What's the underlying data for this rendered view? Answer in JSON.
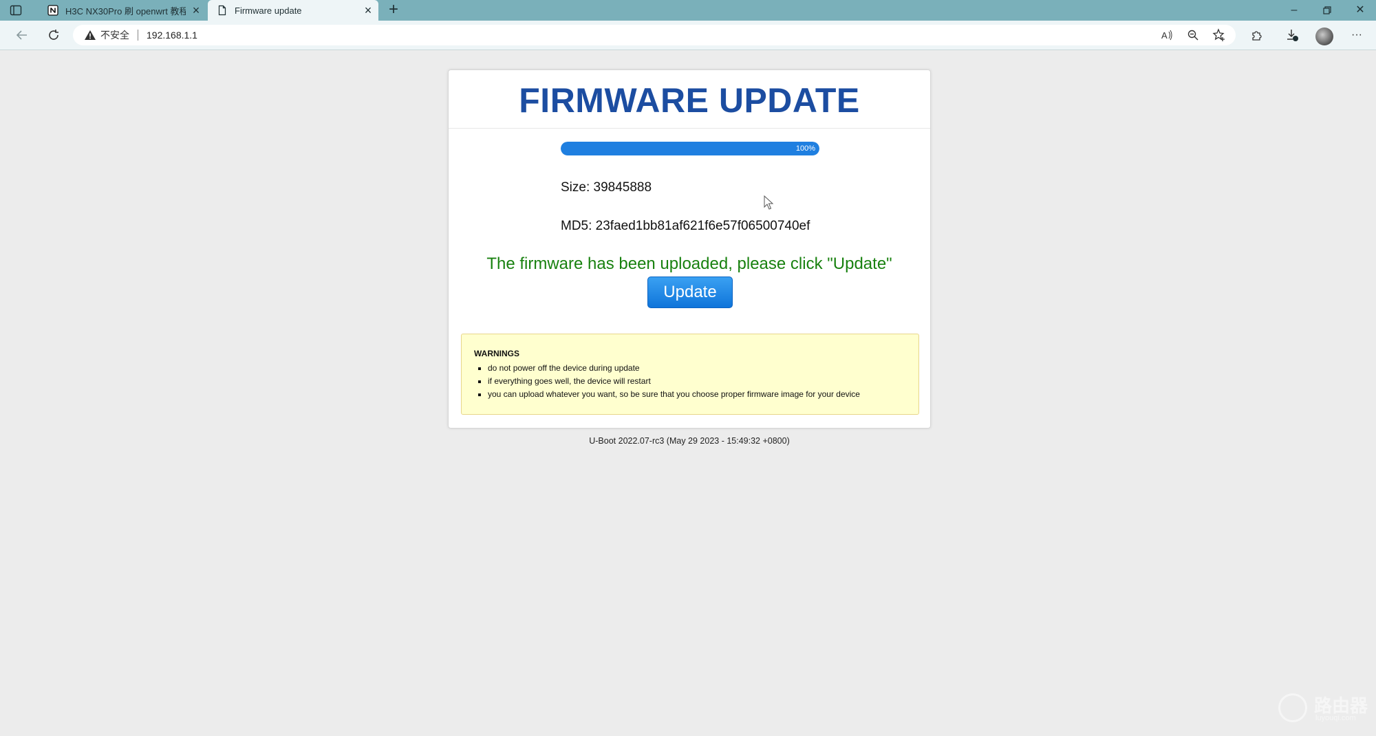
{
  "browser": {
    "tabs": [
      {
        "title": "H3C NX30Pro 刷 openwrt 教程",
        "icon": "notion-icon"
      },
      {
        "title": "Firmware update",
        "icon": "page-icon"
      }
    ],
    "address": {
      "security_label": "不安全",
      "url": "192.168.1.1"
    }
  },
  "page": {
    "title": "FIRMWARE UPDATE",
    "progress": {
      "percent_label": "100%",
      "value": 1.0
    },
    "size_label": "Size: 39845888",
    "md5_label": "MD5: 23faed1bb81af621f6e57f06500740ef",
    "message": "The firmware has been uploaded, please click \"Update\"",
    "update_button": "Update",
    "warnings": {
      "title": "WARNINGS",
      "items": [
        "do not power off the device during update",
        "if everything goes well, the device will restart",
        "you can upload whatever you want, so be sure that you choose proper firmware image for your device"
      ]
    },
    "footer": "U-Boot 2022.07-rc3 (May 29 2023 - 15:49:32 +0800)"
  },
  "watermark": {
    "name": "路由器",
    "site": "luyouqi.com"
  },
  "colors": {
    "title": "#1c4da1",
    "message": "#18810f",
    "progress_fill": "#1f7fe0",
    "button": "#1f84e4",
    "warning_bg": "#ffffcf",
    "tabbar": "#7ab0ba"
  }
}
